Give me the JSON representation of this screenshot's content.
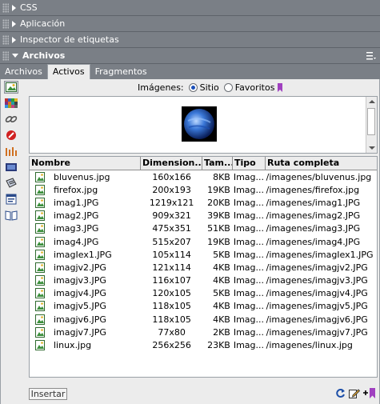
{
  "panels": [
    {
      "title": "CSS"
    },
    {
      "title": "Aplicación"
    },
    {
      "title": "Inspector de etiquetas"
    },
    {
      "title": "Archivos"
    }
  ],
  "tabs": [
    "Archivos",
    "Activos",
    "Fragmentos"
  ],
  "images_bar": {
    "label": "Imágenes:",
    "option_site": "Sitio",
    "option_favorites": "Favoritos",
    "selected": "Sitio"
  },
  "table": {
    "headers": [
      "Nombre",
      "Dimension...",
      "Tam...",
      "Tipo",
      "Ruta completa"
    ],
    "rows": [
      [
        "bluvenus.jpg",
        "160x166",
        "8KB",
        "Imag...",
        "/imagenes/bluvenus.jpg"
      ],
      [
        "firefox.jpg",
        "200x193",
        "19KB",
        "Imag...",
        "/imagenes/firefox.jpg"
      ],
      [
        "imag1.JPG",
        "1219x121",
        "20KB",
        "Imag...",
        "/imagenes/imag1.JPG"
      ],
      [
        "imag2.JPG",
        "909x321",
        "39KB",
        "Imag...",
        "/imagenes/imag2.JPG"
      ],
      [
        "imag3.JPG",
        "475x351",
        "51KB",
        "Imag...",
        "/imagenes/imag3.JPG"
      ],
      [
        "imag4.JPG",
        "515x207",
        "19KB",
        "Imag...",
        "/imagenes/imag4.JPG"
      ],
      [
        "imagIex1.JPG",
        "105x114",
        "5KB",
        "Imag...",
        "/imagenes/imagIex1.JPG"
      ],
      [
        "imagjv2.JPG",
        "121x114",
        "4KB",
        "Imag...",
        "/imagenes/imagjv2.JPG"
      ],
      [
        "imagjv3.JPG",
        "116x107",
        "4KB",
        "Imag...",
        "/imagenes/imagjv3.JPG"
      ],
      [
        "imagjv4.JPG",
        "120x105",
        "5KB",
        "Imag...",
        "/imagenes/imagjv4.JPG"
      ],
      [
        "imagjv5.JPG",
        "118x105",
        "4KB",
        "Imag...",
        "/imagenes/imagjv5.JPG"
      ],
      [
        "imagjv6.JPG",
        "118x105",
        "4KB",
        "Imag...",
        "/imagenes/imagjv6.JPG"
      ],
      [
        "imagjv7.JPG",
        "77x80",
        "2KB",
        "Imag...",
        "/imagenes/imagjv7.JPG"
      ],
      [
        "linux.jpg",
        "256x256",
        "23KB",
        "Imag...",
        "/imagenes/linux.jpg"
      ]
    ]
  },
  "insert_label": "Insertar",
  "colors": {
    "panel_bar": "#7a7f86",
    "content_bg": "#ececec",
    "radio_dot": "#1a4fb8"
  }
}
